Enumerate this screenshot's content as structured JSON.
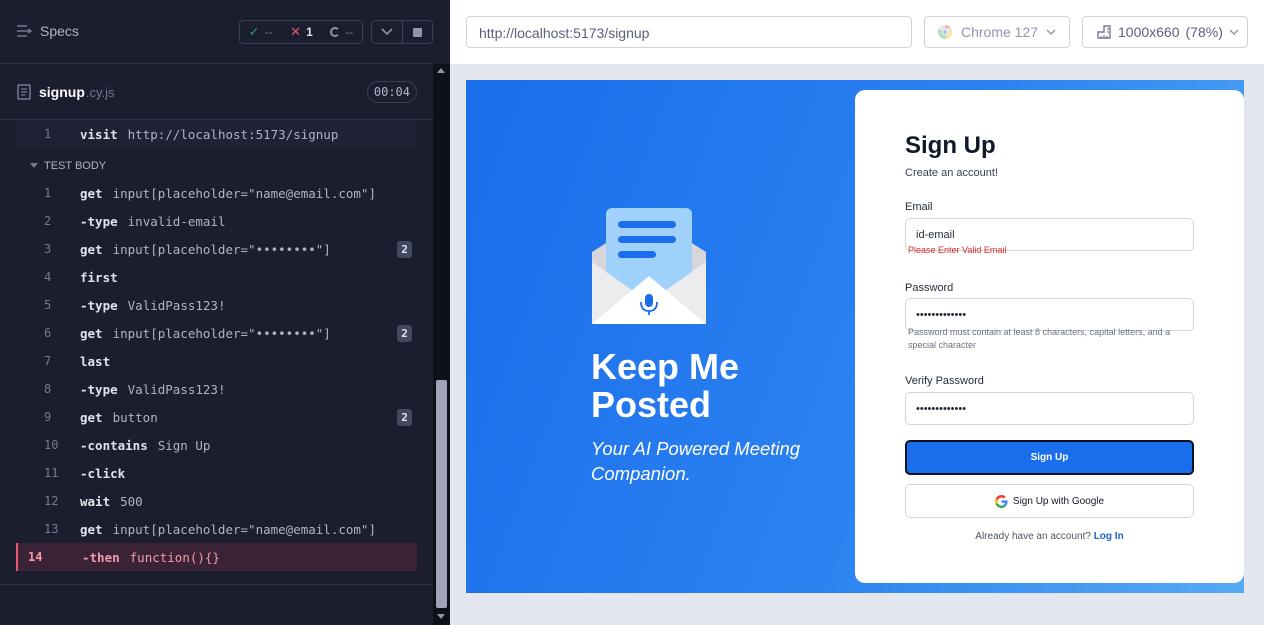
{
  "runner": {
    "specs_label": "Specs",
    "stats": {
      "passed": "--",
      "failed": "1",
      "pending": "--"
    },
    "spec": {
      "name": "signup",
      "ext": ".cy.js",
      "duration": "00:04"
    },
    "visit": {
      "num": "1",
      "name": "visit",
      "arg": "http://localhost:5173/signup"
    },
    "test_body_label": "TEST BODY",
    "commands": [
      {
        "num": "1",
        "name": "get",
        "arg": "input[placeholder=\"name@email.com\"]",
        "badge": ""
      },
      {
        "num": "2",
        "name": "-type",
        "arg": "invalid-email",
        "badge": ""
      },
      {
        "num": "3",
        "name": "get",
        "arg": "input[placeholder=\"••••••••\"]",
        "badge": "2"
      },
      {
        "num": "4",
        "name": "first",
        "arg": "",
        "badge": ""
      },
      {
        "num": "5",
        "name": "-type",
        "arg": "ValidPass123!",
        "badge": ""
      },
      {
        "num": "6",
        "name": "get",
        "arg": "input[placeholder=\"••••••••\"]",
        "badge": "2"
      },
      {
        "num": "7",
        "name": "last",
        "arg": "",
        "badge": ""
      },
      {
        "num": "8",
        "name": "-type",
        "arg": "ValidPass123!",
        "badge": ""
      },
      {
        "num": "9",
        "name": "get",
        "arg": "button",
        "badge": "2"
      },
      {
        "num": "10",
        "name": "-contains",
        "arg": "Sign Up",
        "badge": ""
      },
      {
        "num": "11",
        "name": "-click",
        "arg": "",
        "badge": ""
      },
      {
        "num": "12",
        "name": "wait",
        "arg": "500",
        "badge": ""
      },
      {
        "num": "13",
        "name": "get",
        "arg": "input[placeholder=\"name@email.com\"]",
        "badge": ""
      },
      {
        "num": "14",
        "name": "-then",
        "arg": "function(){}",
        "badge": ""
      }
    ]
  },
  "preview": {
    "url": "http://localhost:5173/signup",
    "browser": "Chrome 127",
    "viewport": "1000x660",
    "zoom": "(78%)"
  },
  "app": {
    "hero_title": "Keep Me Posted",
    "hero_subtitle": "Your AI Powered Meeting Companion.",
    "form_title": "Sign Up",
    "form_subtitle": "Create an account!",
    "email_label": "Email",
    "email_value": "id-email",
    "email_error": "Please Enter Valid Email",
    "password_label": "Password",
    "password_value": "•••••••••••••",
    "password_hint": "Password must contain at least 8 characters, capital letters, and a special character",
    "verify_label": "Verify Password",
    "verify_value": "•••••••••••••",
    "signup_button": "Sign Up",
    "google_button": "Sign Up with Google",
    "footer_text": "Already have an account?",
    "login_link": "Log In"
  },
  "colors": {
    "runner_bg": "#1b1e2e",
    "failed_row": "#3b2337",
    "accent_blue": "#1a6deb",
    "error_red": "#dc2626"
  }
}
